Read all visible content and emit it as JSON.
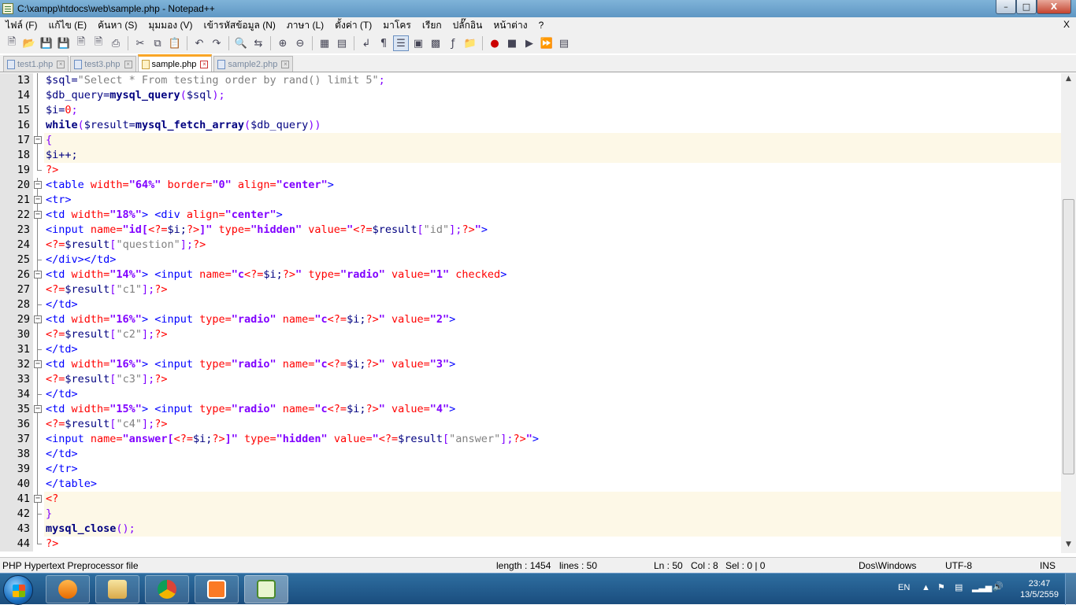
{
  "window": {
    "title": "C:\\xampp\\htdocs\\web\\sample.php - Notepad++",
    "minimize": "–",
    "maximize": "□",
    "close": "X"
  },
  "menu": {
    "items": [
      "ไฟล์ (F)",
      "แก้ไข (E)",
      "ค้นหา (S)",
      "มุมมอง (V)",
      "เข้ารหัสข้อมูล (N)",
      "ภาษา (L)",
      "ตั้งค่า (T)",
      "มาโคร",
      "เรียก",
      "ปลั๊กอิน",
      "หน้าต่าง",
      "?"
    ],
    "close": "X"
  },
  "tabs": [
    {
      "label": "test1.php",
      "active": false
    },
    {
      "label": "test3.php",
      "active": false
    },
    {
      "label": "sample.php",
      "active": true
    },
    {
      "label": "sample2.php",
      "active": false
    }
  ],
  "editor": {
    "lines": [
      {
        "n": "13",
        "fold": "line"
      },
      {
        "n": "14",
        "fold": "line"
      },
      {
        "n": "15",
        "fold": "line"
      },
      {
        "n": "16",
        "fold": "line"
      },
      {
        "n": "17",
        "fold": "box"
      },
      {
        "n": "18",
        "fold": "line"
      },
      {
        "n": "19",
        "fold": "end"
      },
      {
        "n": "20",
        "fold": "box"
      },
      {
        "n": "21",
        "fold": "box"
      },
      {
        "n": "22",
        "fold": "box"
      },
      {
        "n": "23",
        "fold": "line"
      },
      {
        "n": "24",
        "fold": "line"
      },
      {
        "n": "25",
        "fold": "end"
      },
      {
        "n": "26",
        "fold": "box"
      },
      {
        "n": "27",
        "fold": "line"
      },
      {
        "n": "28",
        "fold": "end"
      },
      {
        "n": "29",
        "fold": "box"
      },
      {
        "n": "30",
        "fold": "line"
      },
      {
        "n": "31",
        "fold": "end"
      },
      {
        "n": "32",
        "fold": "box"
      },
      {
        "n": "33",
        "fold": "line"
      },
      {
        "n": "34",
        "fold": "end"
      },
      {
        "n": "35",
        "fold": "box"
      },
      {
        "n": "36",
        "fold": "line"
      },
      {
        "n": "37",
        "fold": "line"
      },
      {
        "n": "38",
        "fold": "line"
      },
      {
        "n": "39",
        "fold": "line"
      },
      {
        "n": "40",
        "fold": "line"
      },
      {
        "n": "41",
        "fold": "box"
      },
      {
        "n": "42",
        "fold": "end"
      },
      {
        "n": "43",
        "fold": "line"
      },
      {
        "n": "44",
        "fold": "end"
      }
    ],
    "code": {
      "l13": [
        "$sql=",
        "\"Select * From testing order by rand() limit 5\"",
        ";"
      ],
      "l14": [
        "$db_query=",
        "mysql_query",
        "(",
        "$sql",
        ");"
      ],
      "l15": [
        "$i=",
        "0",
        ";"
      ],
      "l16": [
        "while",
        "(",
        "$result=",
        "mysql_fetch_array",
        "(",
        "$db_query",
        "))"
      ],
      "l17": [
        "{"
      ],
      "l18": [
        "$i++;"
      ],
      "l19": [
        "?>"
      ],
      "l20": [
        "<table ",
        "width=",
        "\"64%\" ",
        "border=",
        "\"0\" ",
        "align=",
        "\"center\"",
        ">"
      ],
      "l21": [
        "<tr>"
      ],
      "l22": [
        "<td ",
        "width=",
        "\"18%\"",
        "> <div ",
        "align=",
        "\"center\"",
        ">"
      ],
      "l23": [
        "<input ",
        "name=",
        "\"id[",
        "<?=",
        "$i;",
        "?>",
        "]\" ",
        "type=",
        "\"hidden\" ",
        "value=",
        "\"",
        "<?=",
        "$result",
        "[",
        "\"id\"",
        "];",
        "?>",
        "\"",
        ">"
      ],
      "l24": [
        "<?=",
        "$result",
        "[",
        "\"question\"",
        "];",
        "?>"
      ],
      "l25": [
        "</div></td>"
      ],
      "l26": [
        "<td ",
        "width=",
        "\"14%\"",
        "> <input ",
        "name=",
        "\"c",
        "<?=",
        "$i;",
        "?>",
        "\" ",
        "type=",
        "\"radio\" ",
        "value=",
        "\"1\" ",
        "checked",
        ">"
      ],
      "l27": [
        "<?=",
        "$result",
        "[",
        "\"c1\"",
        "];",
        "?>"
      ],
      "l28": [
        "</td>"
      ],
      "l29": [
        "<td ",
        "width=",
        "\"16%\"",
        "> <input ",
        "type=",
        "\"radio\" ",
        "name=",
        "\"c",
        "<?=",
        "$i;",
        "?>",
        "\" ",
        "value=",
        "\"2\"",
        ">"
      ],
      "l30": [
        "<?=",
        "$result",
        "[",
        "\"c2\"",
        "];",
        "?>"
      ],
      "l31": [
        "</td>"
      ],
      "l32": [
        "<td ",
        "width=",
        "\"16%\"",
        "> <input ",
        "type=",
        "\"radio\" ",
        "name=",
        "\"c",
        "<?=",
        "$i;",
        "?>",
        "\" ",
        "value=",
        "\"3\"",
        ">"
      ],
      "l33": [
        "<?=",
        "$result",
        "[",
        "\"c3\"",
        "];",
        "?>"
      ],
      "l34": [
        "</td>"
      ],
      "l35": [
        "<td ",
        "width=",
        "\"15%\"",
        "> <input ",
        "type=",
        "\"radio\" ",
        "name=",
        "\"c",
        "<?=",
        "$i;",
        "?>",
        "\" ",
        "value=",
        "\"4\"",
        ">"
      ],
      "l36": [
        "<?=",
        "$result",
        "[",
        "\"c4\"",
        "];",
        "?>"
      ],
      "l37": [
        "<input ",
        "name=",
        "\"answer[",
        "<?=",
        "$i;",
        "?>",
        "]\" ",
        "type=",
        "\"hidden\" ",
        "value=",
        "\"",
        "<?=",
        "$result",
        "[",
        "\"answer\"",
        "];",
        "?>",
        "\"",
        ">"
      ],
      "l38": [
        "</td>"
      ],
      "l39": [
        "</tr>"
      ],
      "l40": [
        "</table>"
      ],
      "l41": [
        "<?"
      ],
      "l42": [
        "}"
      ],
      "l43": [
        "mysql_close",
        "();"
      ],
      "l44": [
        "?>"
      ]
    }
  },
  "status": {
    "filetype": "PHP Hypertext Preprocessor file",
    "length": "length : 1454",
    "lines": "lines : 50",
    "ln": "Ln : 50",
    "col": "Col : 8",
    "sel": "Sel : 0 | 0",
    "eol": "Dos\\Windows",
    "encoding": "UTF-8",
    "mode": "INS"
  },
  "taskbar": {
    "lang": "EN",
    "time": "23:47",
    "date": "13/5/2559",
    "icons": [
      "media-player-icon",
      "file-explorer-icon",
      "chrome-icon",
      "xampp-icon",
      "notepadpp-icon"
    ]
  }
}
